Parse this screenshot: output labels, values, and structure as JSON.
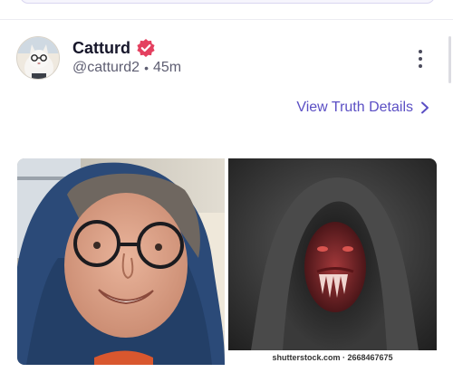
{
  "post": {
    "author_name": "Catturd",
    "handle": "@catturd2",
    "separator": "•",
    "timestamp": "45m",
    "details_link": "View Truth Details",
    "watermark": "shutterstock.com · 2668467675"
  },
  "icons": {
    "verified": "verified-badge-icon",
    "more": "more-vertical-icon",
    "details_chevron": "chevron-right-icon"
  },
  "colors": {
    "accent": "#5b4fc4",
    "verified_badge": "#e4405f"
  }
}
